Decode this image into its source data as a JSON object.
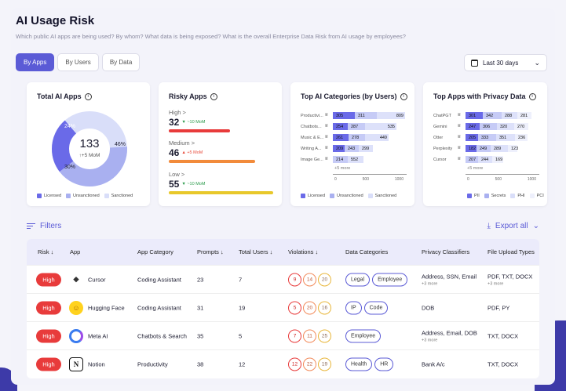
{
  "header": {
    "title": "AI Usage Risk",
    "subtitle": "Which public AI apps are being used? By whom? What data is being exposed? What is the overall Enterprise Data Risk from AI usage by employees?"
  },
  "tabs": [
    "By Apps",
    "By Users",
    "By Data"
  ],
  "date_range": "Last 30 days",
  "total_ai_apps": {
    "title": "Total AI Apps",
    "value": "133",
    "change": "+5 MoM",
    "segments": [
      {
        "label": "24%",
        "value": 24,
        "color": "#6a6ae8"
      },
      {
        "label": "30%",
        "value": 30,
        "color": "#a9b0f0"
      },
      {
        "label": "46%",
        "value": 46,
        "color": "#d9def9"
      }
    ],
    "legend": [
      "Licensed",
      "Unsanctioned",
      "Sanctioned"
    ]
  },
  "risky_apps": {
    "title": "Risky Apps",
    "levels": [
      {
        "name": "High",
        "value": "32",
        "change": "~10 MoM",
        "dir": "▼",
        "color": "#e83b3b",
        "fill": 0.6
      },
      {
        "name": "Medium",
        "value": "46",
        "change": "+5 MoM",
        "dir": "▲",
        "color": "#f28b3b",
        "fill": 0.75
      },
      {
        "name": "Low",
        "value": "55",
        "change": "~10 MoM",
        "dir": "▼",
        "color": "#e8c82b",
        "fill": 0.9
      }
    ]
  },
  "top_categories": {
    "title": "Top AI Categories (by Users)",
    "rows": [
      {
        "label": "Productivi...",
        "vals": [
          "305",
          "311",
          "809"
        ]
      },
      {
        "label": "Chatbots...",
        "vals": [
          "254",
          "287",
          "535"
        ]
      },
      {
        "label": "Music & E...",
        "vals": [
          "261",
          "278",
          "449"
        ]
      },
      {
        "label": "Writing A...",
        "vals": [
          "209",
          "243",
          "299"
        ]
      },
      {
        "label": "Image Ge...",
        "vals": [
          "214",
          "552"
        ]
      }
    ],
    "more": "+5 more",
    "axis": [
      "0",
      "500",
      "1000"
    ],
    "legend": [
      "Licensed",
      "Unsanctioned",
      "Sanctioned"
    ]
  },
  "top_privacy": {
    "title": "Top Apps with Privacy Data",
    "rows": [
      {
        "label": "ChatPGT",
        "vals": [
          "301",
          "342",
          "288",
          "281"
        ]
      },
      {
        "label": "Gemini",
        "vals": [
          "247",
          "306",
          "320",
          "270"
        ]
      },
      {
        "label": "Otter",
        "vals": [
          "205",
          "333",
          "351",
          "236"
        ]
      },
      {
        "label": "Perplexity",
        "vals": [
          "182",
          "249",
          "289",
          "123"
        ]
      },
      {
        "label": "Cursor",
        "vals": [
          "207",
          "244",
          "169"
        ]
      }
    ],
    "more": "+5 more",
    "axis": [
      "0",
      "500",
      "1000"
    ],
    "legend": [
      "PII",
      "Secrets",
      "PHI",
      "PCI"
    ]
  },
  "filters_label": "Filters",
  "export_label": "Export all",
  "table": {
    "headers": [
      "Risk ↓",
      "App",
      "App Category",
      "Prompts ↓",
      "Total Users ↓",
      "Violations ↓",
      "Data Categories",
      "Privacy Classifiers",
      "File Upload Types"
    ],
    "rows": [
      {
        "risk": "High",
        "app": "Cursor",
        "icon": "cursor-logo-icon",
        "category": "Coding Assistant",
        "prompts": "23",
        "users": "7",
        "violations": [
          "9",
          "14",
          "20"
        ],
        "data_categories": [
          "Legal",
          "Employee"
        ],
        "privacy": "Address, SSN, Email",
        "privacy_more": "+3 more",
        "files": "PDF, TXT, DOCX",
        "files_more": "+3 more"
      },
      {
        "risk": "High",
        "app": "Hugging Face",
        "icon": "hugging-face-logo-icon",
        "category": "Coding Assistant",
        "prompts": "31",
        "users": "19",
        "violations": [
          "5",
          "20",
          "16"
        ],
        "data_categories": [
          "IP",
          "Code"
        ],
        "privacy": "DOB",
        "privacy_more": "",
        "files": "PDF, PY",
        "files_more": ""
      },
      {
        "risk": "High",
        "app": "Meta AI",
        "icon": "meta-ai-logo-icon",
        "category": "Chatbots & Search",
        "prompts": "35",
        "users": "5",
        "violations": [
          "7",
          "11",
          "25"
        ],
        "data_categories": [
          "Employee"
        ],
        "privacy": "Address, Email, DOB",
        "privacy_more": "+3 more",
        "files": "TXT, DOCX",
        "files_more": ""
      },
      {
        "risk": "High",
        "app": "Notion",
        "icon": "notion-logo-icon",
        "category": "Productivity",
        "prompts": "38",
        "users": "12",
        "violations": [
          "12",
          "22",
          "19"
        ],
        "data_categories": [
          "Health",
          "HR"
        ],
        "privacy": "Bank A/c",
        "privacy_more": "",
        "files": "TXT, DOCX",
        "files_more": ""
      }
    ]
  }
}
